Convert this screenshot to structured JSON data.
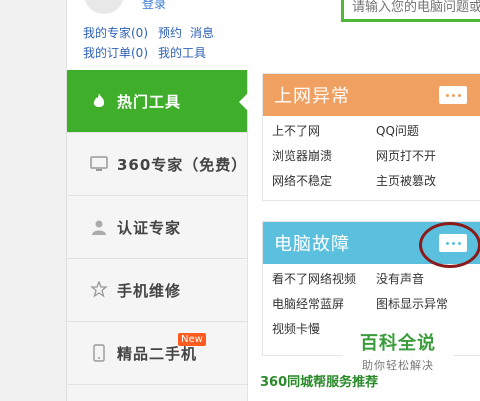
{
  "user_box": {
    "login_text": "登录",
    "links": [
      {
        "label": "我的专家(0)"
      },
      {
        "label": "预约"
      },
      {
        "label": "消息"
      },
      {
        "label": "我的订单(0)"
      },
      {
        "label": "我的工具"
      }
    ]
  },
  "search": {
    "placeholder": "请输入您的电脑问题或"
  },
  "sidebar": {
    "items": [
      {
        "label": "热门工具",
        "icon": "flame-icon",
        "active": true
      },
      {
        "label": "360专家（免费）",
        "icon": "monitor-icon"
      },
      {
        "label": "认证专家",
        "icon": "user-icon"
      },
      {
        "label": "手机维修",
        "icon": "wrench-star-icon"
      },
      {
        "label": "精品二手机",
        "icon": "phone-icon",
        "badge": "New"
      }
    ]
  },
  "panels": [
    {
      "title": "上网异常",
      "color": "#f0a060",
      "links": [
        "上不了网",
        "QQ问题",
        "浏览器崩溃",
        "网页打不开",
        "网络不稳定",
        "主页被篡改"
      ]
    },
    {
      "title": "电脑故障",
      "color": "#5bc0de",
      "links": [
        "看不了网络视频",
        "没有声音",
        "电脑经常蓝屏",
        "图标显示异常",
        "视频卡慢",
        ""
      ]
    }
  ],
  "watermark": {
    "main": "百科全说",
    "sub": "助你轻松解决"
  },
  "footer": {
    "title": "360同城帮服务推荐"
  },
  "colors": {
    "active": "#3fae2a",
    "annotation": "#8b1a1a"
  }
}
